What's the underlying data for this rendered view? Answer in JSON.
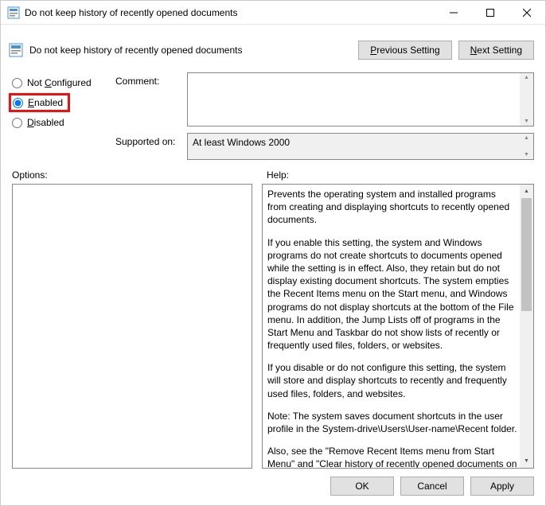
{
  "window": {
    "title": "Do not keep history of recently opened documents"
  },
  "header": {
    "title": "Do not keep history of recently opened documents",
    "previous": "Previous Setting",
    "next": "Next Setting"
  },
  "radios": {
    "not_configured": "Not Configured",
    "enabled": "Enabled",
    "disabled": "Disabled"
  },
  "labels": {
    "comment": "Comment:",
    "supported_on": "Supported on:",
    "options": "Options:",
    "help": "Help:"
  },
  "supported_on": "At least Windows 2000",
  "help": {
    "p1": "Prevents the operating system and installed programs from creating and displaying shortcuts to recently opened documents.",
    "p2": "If you enable this setting, the system and Windows programs do not create shortcuts to documents opened while the setting is in effect. Also, they retain but do not display existing document shortcuts. The system empties the Recent Items menu on the Start menu, and Windows programs do not display shortcuts at the bottom of the File menu. In addition, the Jump Lists off of programs in the Start Menu and Taskbar do not show lists of recently or frequently used files, folders, or websites.",
    "p3": "If you disable or do not configure this setting, the system will store and display shortcuts to recently and frequently used files, folders, and websites.",
    "p4": "Note: The system saves document shortcuts in the user profile in the System-drive\\Users\\User-name\\Recent folder.",
    "p5": "Also, see the \"Remove Recent Items menu from Start Menu\" and \"Clear history of recently opened documents on exit\" policies in"
  },
  "footer": {
    "ok": "OK",
    "cancel": "Cancel",
    "apply": "Apply"
  }
}
